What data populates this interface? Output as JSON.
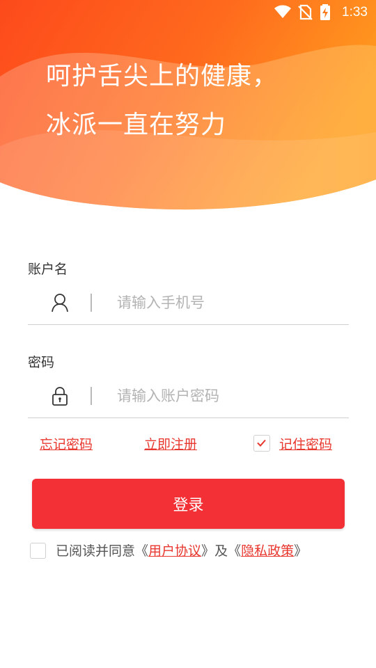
{
  "status_bar": {
    "time": "1:33",
    "icons": [
      "wifi-icon",
      "no-sim-icon",
      "battery-charging-icon"
    ]
  },
  "header": {
    "slogan_line1": "呵护舌尖上的健康，",
    "slogan_line2": "冰派一直在努力",
    "gradient_colors": [
      "#fd4d1f",
      "#ff8a1a",
      "#ffb43d"
    ]
  },
  "account": {
    "label": "账户名",
    "icon": "user-icon",
    "placeholder": "请输入手机号",
    "value": ""
  },
  "password": {
    "label": "密码",
    "icon": "lock-icon",
    "placeholder": "请输入账户密码",
    "value": ""
  },
  "links": {
    "forgot": "忘记密码",
    "register": "立即注册",
    "remember": "记住密码",
    "remember_checked": true
  },
  "login_button": "登录",
  "agreement": {
    "checked": false,
    "prefix": "已阅读并同意",
    "open1": "《",
    "user_agreement": "用户协议",
    "close1": "》",
    "and": "及",
    "open2": "《",
    "privacy_policy": "隐私政策",
    "close2": "》"
  },
  "colors": {
    "accent_red": "#f23035",
    "link_red": "#e8372e"
  }
}
